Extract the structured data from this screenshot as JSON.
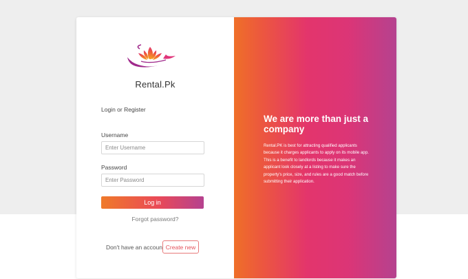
{
  "brand": {
    "name": "Rental.Pk"
  },
  "form": {
    "subtitle": "Login or Register",
    "username_label": "Username",
    "username_placeholder": "Enter Username",
    "password_label": "Password",
    "password_placeholder": "Enter Password",
    "login_button": "Log in",
    "forgot_link": "Forgot password?",
    "no_account_text": "Don't have an account?",
    "create_button": "Create new"
  },
  "promo": {
    "headline": "We are more than just a company",
    "body": "Rental.PK is best for attracting qualified applicants because it charges applicants to apply on its mobile app. This is a benefit to landlords because it makes an applicant look closely at a listing to make sure the property's price, size, and rules are a good match before submitting their application."
  },
  "colors": {
    "gradient_start": "#ef6f28",
    "gradient_mid": "#e3356c",
    "gradient_end": "#b5428f",
    "logo_purple": "#a02a8c"
  },
  "icons": {
    "logo": "lotus-logo-icon"
  }
}
